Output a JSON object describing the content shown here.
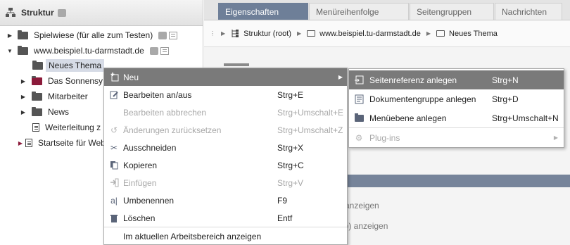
{
  "structure_panel": {
    "title": "Struktur",
    "tree": [
      {
        "label": "Spielwiese (für alle zum Testen)",
        "type": "folder",
        "expanded": false
      },
      {
        "label": "www.beispiel.tu-darmstadt.de",
        "type": "folder",
        "expanded": true
      },
      {
        "label": "Neues Thema",
        "type": "folder",
        "selected": true
      },
      {
        "label": "Das Sonnensy",
        "type": "folder"
      },
      {
        "label": "Mitarbeiter",
        "type": "folder"
      },
      {
        "label": "News",
        "type": "folder"
      },
      {
        "label": "Weiterleitung z",
        "type": "doc"
      },
      {
        "label": "Startseite für Web",
        "type": "doc"
      }
    ]
  },
  "tabs": [
    "Eigenschaften",
    "Menüreihenfolge",
    "Seitengruppen",
    "Nachrichten"
  ],
  "breadcrumb": [
    "Struktur (root)",
    "www.beispiel.tu-darmstadt.de",
    "Neues Thema"
  ],
  "background_text": {
    "line1": "i anzeigen",
    "line2": "ap) anzeigen"
  },
  "context_menu": {
    "items": [
      {
        "label": "Neu",
        "shortcut": "",
        "icon": "new-icon",
        "hover": true,
        "submenu": true
      },
      {
        "label": "Bearbeiten an/aus",
        "shortcut": "Strg+E",
        "icon": "edit-icon"
      },
      {
        "label": "Bearbeiten abbrechen",
        "shortcut": "Strg+Umschalt+E",
        "icon": "",
        "disabled": true
      },
      {
        "label": "Änderungen zurücksetzen",
        "shortcut": "Strg+Umschalt+Z",
        "icon": "undo-icon",
        "disabled": true
      },
      {
        "label": "Ausschneiden",
        "shortcut": "Strg+X",
        "icon": "scissors-icon"
      },
      {
        "label": "Kopieren",
        "shortcut": "Strg+C",
        "icon": "copy-icon"
      },
      {
        "label": "Einfügen",
        "shortcut": "Strg+V",
        "icon": "paste-icon",
        "disabled": true
      },
      {
        "label": "Umbenennen",
        "shortcut": "F9",
        "icon": "rename-icon"
      },
      {
        "label": "Löschen",
        "shortcut": "Entf",
        "icon": "trash-icon"
      },
      {
        "label": "Im aktuellen Arbeitsbereich anzeigen",
        "shortcut": "",
        "icon": ""
      }
    ]
  },
  "submenu": {
    "items": [
      {
        "label": "Seitenreferenz anlegen",
        "shortcut": "Strg+N",
        "hover": true
      },
      {
        "label": "Dokumentengruppe anlegen",
        "shortcut": "Strg+D"
      },
      {
        "label": "Menüebene anlegen",
        "shortcut": "Strg+Umschalt+N"
      },
      {
        "label": "Plug-ins",
        "shortcut": "",
        "disabled": true
      }
    ]
  }
}
